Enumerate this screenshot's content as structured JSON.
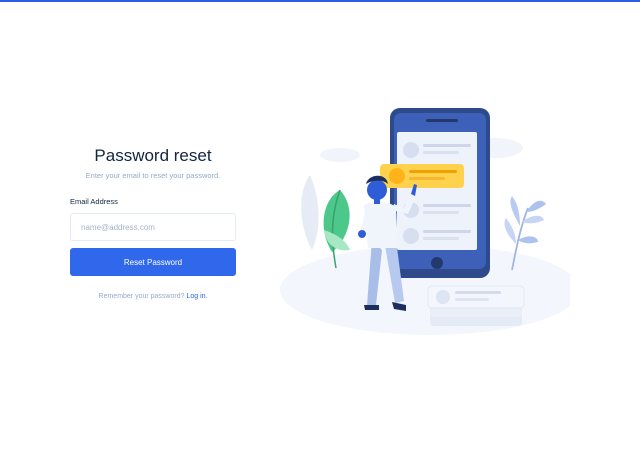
{
  "form": {
    "title": "Password reset",
    "subtitle": "Enter your email to reset your password.",
    "email_label": "Email Address",
    "email_placeholder": "name@address.com",
    "email_value": "",
    "submit_label": "Reset Password",
    "remember_text": "Remember your password?",
    "login_link": "Log in."
  },
  "colors": {
    "accent": "#2f68ea",
    "topbar": "#2c5fe8",
    "title": "#12263f",
    "muted": "#95aac9"
  },
  "illustration": {
    "name": "phone-user-illustration"
  }
}
